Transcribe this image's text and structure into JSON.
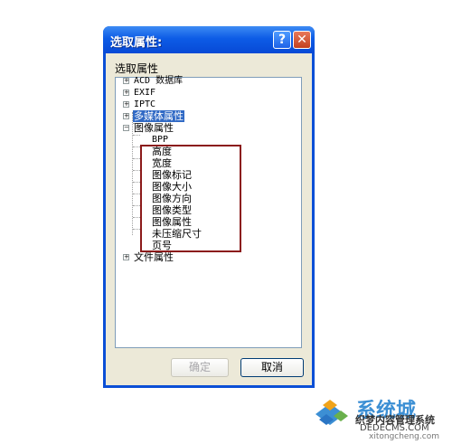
{
  "dialog": {
    "title": "选取属性:",
    "help_glyph": "?",
    "close_glyph": "✕",
    "group_label": "选取属性",
    "tree": {
      "roots": [
        {
          "label": "ACD 数据库",
          "expander": "+"
        },
        {
          "label": "EXIF",
          "expander": "+"
        },
        {
          "label": "IPTC",
          "expander": "+"
        },
        {
          "label": "多媒体属性",
          "expander": "+",
          "selected": true
        },
        {
          "label": "图像属性",
          "expander": "−"
        },
        {
          "label": "文件属性",
          "expander": "+"
        }
      ],
      "image_children": [
        "BPP",
        "高度",
        "宽度",
        "图像标记",
        "图像大小",
        "图像方向",
        "图像类型",
        "图像属性",
        "未压缩尺寸",
        "页号"
      ]
    },
    "buttons": {
      "ok_label": "确定",
      "cancel_label": "取消"
    }
  },
  "watermark": {
    "brand": "系统城",
    "slogan": "织梦内容管理系统",
    "url": "DEDECMS.COM",
    "sub_url": "xitongcheng.com"
  },
  "colors": {
    "title_bar": "#0b4fd6",
    "selection": "#316ac5",
    "highlight_box": "#8b1a1a"
  }
}
